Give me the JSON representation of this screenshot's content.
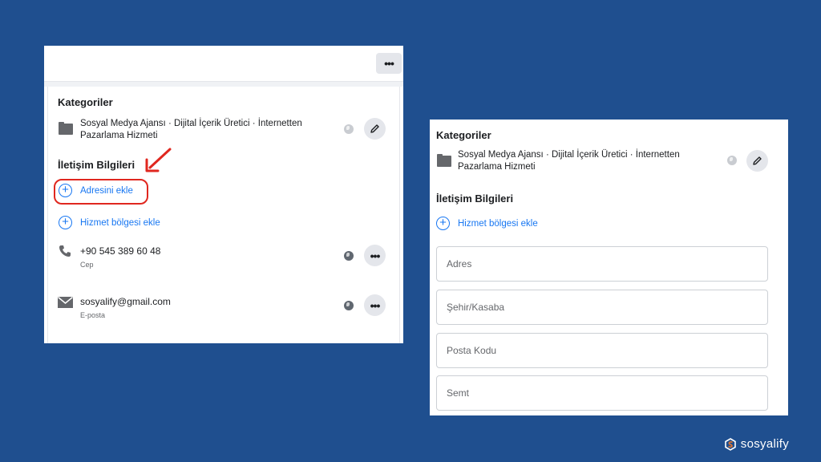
{
  "left_panel": {
    "more_label": "•••",
    "categories_heading": "Kategoriler",
    "category_text": "Sosyal Medya Ajansı · Dijital İçerik Üretici · İnternetten Pazarlama Hizmeti",
    "contact_heading": "İletişim Bilgileri",
    "add_address_label": "Adresini ekle",
    "add_service_area_label": "Hizmet bölgesi ekle",
    "phone": {
      "value": "+90 545 389 60 48",
      "type": "Cep"
    },
    "email": {
      "value": "sosyalify@gmail.com",
      "type": "E-posta"
    },
    "dots_label": "•••",
    "plus_symbol": "+"
  },
  "right_panel": {
    "categories_heading": "Kategoriler",
    "category_text": "Sosyal Medya Ajansı · Dijital İçerik Üretici · İnternetten Pazarlama Hizmeti",
    "contact_heading": "İletişim Bilgileri",
    "add_service_area_label": "Hizmet bölgesi ekle",
    "plus_symbol": "+",
    "fields": {
      "address_placeholder": "Adres",
      "city_placeholder": "Şehir/Kasaba",
      "postal_placeholder": "Posta Kodu",
      "district_placeholder": "Semt"
    }
  },
  "brand": {
    "name": "sosyalify"
  },
  "colors": {
    "background": "#1f4f8f",
    "link_blue": "#1877f2",
    "highlight_red": "#e0271f",
    "text_dark": "#1c1e21",
    "text_muted": "#65676b"
  },
  "icons": [
    "more-icon",
    "category-icon",
    "globe-icon",
    "pencil-icon",
    "plus-circle-icon",
    "phone-icon",
    "mail-icon",
    "red-arrow-icon",
    "sosyalify-logo-icon"
  ]
}
